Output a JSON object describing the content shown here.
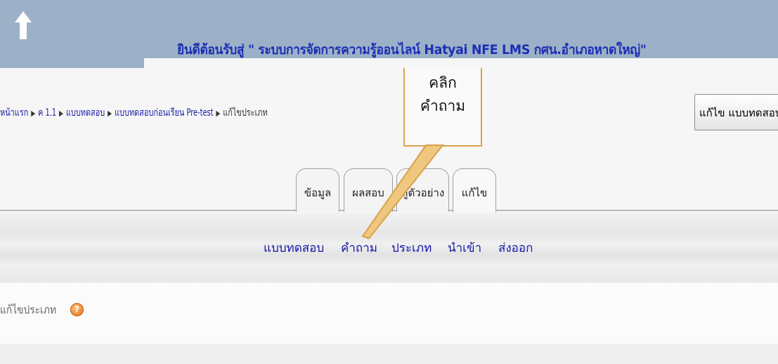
{
  "header": {
    "home_icon": "home-arrow-icon",
    "banner": "ยินดีต้อนรับสู่ \" ระบบการจัดการความรู้ออนไลน์ Hatyai NFE LMS กศน.อำเภอหาดใหญ่\"",
    "bg_color": "#9cb1c8",
    "banner_color": "#1d2fb3"
  },
  "breadcrumb": {
    "items": [
      "หน้าแรก",
      "ค 1.1",
      "แบบทดสอบ",
      "แบบทดสอบก่อนเรียน Pre-test",
      "แก้ไขประเภท"
    ],
    "separator": "▶"
  },
  "edit_button": {
    "label": "แก้ไข แบบทดสอบ"
  },
  "callout": {
    "text": "คลิกคำถาม",
    "color": "#d9a24a"
  },
  "tabs": [
    {
      "label": "ข้อมูล"
    },
    {
      "label": "ผลสอบ"
    },
    {
      "label": "ดูตัวอย่าง"
    },
    {
      "label": "แก้ไข",
      "active": true
    }
  ],
  "subnav": [
    {
      "label": "แบบทดสอบ"
    },
    {
      "label": "คำถาม"
    },
    {
      "label": "ประเภท"
    },
    {
      "label": "นำเข้า"
    },
    {
      "label": "ส่งออก"
    }
  ],
  "section": {
    "title": "แก้ไขประเภท",
    "help_icon": "help-icon",
    "help_glyph": "?"
  },
  "colors": {
    "link": "#1616a8"
  }
}
